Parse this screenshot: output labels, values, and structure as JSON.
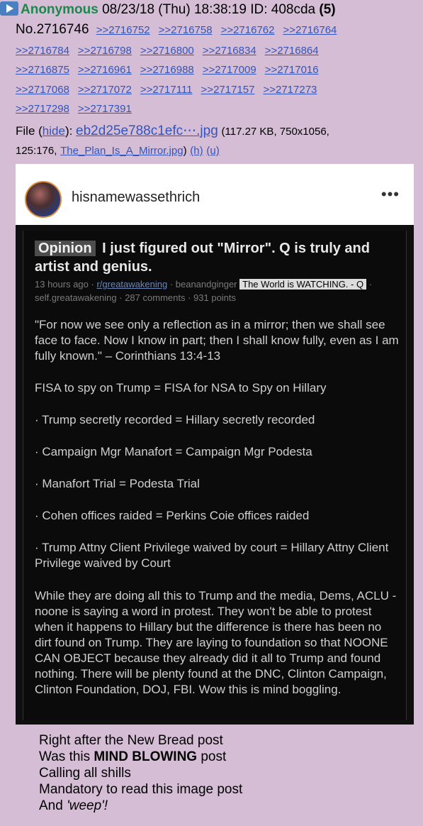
{
  "post": {
    "name": "Anonymous",
    "datetime": "08/23/18 (Thu) 18:38:19",
    "id_label": "ID: 408cda",
    "id_count": "(5)",
    "number": "No.2716746",
    "replies": [
      ">>2716752",
      ">>2716758",
      ">>2716762",
      ">>2716764",
      ">>2716784",
      ">>2716798",
      ">>2716800",
      ">>2716834",
      ">>2716864",
      ">>2716875",
      ">>2716961",
      ">>2716988",
      ">>2717009",
      ">>2717016",
      ">>2717068",
      ">>2717072",
      ">>2717111",
      ">>2717157",
      ">>2717273",
      ">>2717298",
      ">>2717391"
    ]
  },
  "file": {
    "label": "File",
    "hide": "hide",
    "filename": "eb2d25e788c1efc⋯.jpg",
    "info": "(117.27 KB, 750x1056,",
    "ratio": "125:176,",
    "original": "The_Plan_Is_A_Mirror.jpg",
    "h_link": "(h)",
    "u_link": "(u)"
  },
  "image": {
    "username": "hisnamewassethrich",
    "more": "•••",
    "badge": "Opinion",
    "title": "I just figured out \"Mirror\". Q is truly and artist and genius.",
    "meta_time": "13 hours ago",
    "meta_sub": "r/greatawakening",
    "meta_user": "beanandginger",
    "meta_flair": "The World is WATCHING. - Q",
    "meta_domain": "self.greatawakening",
    "meta_comments": "287 comments",
    "meta_points": "931 points",
    "paragraphs": [
      "\"For now we see only a reflection as in a mirror; then we shall see face to face. Now I know in part; then I shall know fully, even as I am fully known.\" – Corinthians 13:4-13",
      "FISA to spy on Trump = FISA for NSA to Spy on Hillary",
      "· Trump secretly recorded = Hillary secretly recorded",
      "· Campaign Mgr Manafort = Campaign Mgr Podesta",
      "· Manafort Trial = Podesta Trial",
      "· Cohen offices raided = Perkins Coie offices raided",
      "· Trump Attny Client Privilege waived by court = Hillary Attny Client Privilege waived by Court",
      "While they are doing all this to Trump and the media, Dems, ACLU - noone is saying a word in protest. They won't be able to protest when it happens to Hillary but the difference is there has been no dirt found on Trump. They are laying to foundation so that NOONE CAN OBJECT because they already did it all to Trump and found nothing. There will be plenty found at the DNC, Clinton Campaign, Clinton Foundation, DOJ, FBI. Wow this is mind boggling."
    ]
  },
  "caption": {
    "line1": "Right after the New Bread post",
    "line2_pre": "Was this",
    "line2_bold": "MIND BLOWING",
    "line2_post": "post",
    "line3": "Calling all shills",
    "line4": "Mandatory to read this image post",
    "line5_pre": "And",
    "line5_ital": "'weep'!"
  }
}
